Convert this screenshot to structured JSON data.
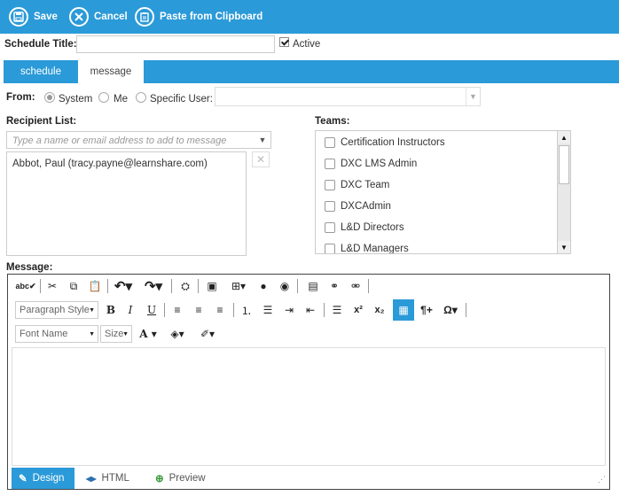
{
  "toolbar": {
    "save_label": "Save",
    "cancel_label": "Cancel",
    "paste_label": "Paste from Clipboard",
    "accent": "#2b9ad8"
  },
  "schedule": {
    "title_label": "Schedule Title:",
    "title_value": "",
    "active_label": "Active",
    "active_checked": true
  },
  "tabs": [
    {
      "label": "schedule",
      "active": false
    },
    {
      "label": "message",
      "active": true
    }
  ],
  "from": {
    "label": "From:",
    "options": [
      {
        "label": "System",
        "selected": true
      },
      {
        "label": "Me",
        "selected": false
      },
      {
        "label": "Specific User:",
        "selected": false
      }
    ],
    "specific_user_value": ""
  },
  "recipients": {
    "label": "Recipient List:",
    "placeholder": "Type a name or email address to add to message",
    "items": [
      "Abbot, Paul (tracy.payne@learnshare.com)"
    ],
    "remove_icon": "close-icon"
  },
  "teams": {
    "label": "Teams:",
    "items": [
      {
        "label": "Certification Instructors",
        "checked": false
      },
      {
        "label": "DXC LMS Admin",
        "checked": false
      },
      {
        "label": "DXC Team",
        "checked": false
      },
      {
        "label": "DXCAdmin",
        "checked": false
      },
      {
        "label": "L&D Directors",
        "checked": false
      },
      {
        "label": "L&D Managers",
        "checked": false
      }
    ]
  },
  "message": {
    "label": "Message:",
    "paragraph_style": "Paragraph Style",
    "font_name": "Font Name",
    "font_size": "Size",
    "body": "",
    "modes": [
      {
        "label": "Design",
        "active": true,
        "icon": "pencil-icon"
      },
      {
        "label": "HTML",
        "active": false,
        "icon": "code-icon"
      },
      {
        "label": "Preview",
        "active": false,
        "icon": "magnify-icon"
      }
    ]
  }
}
